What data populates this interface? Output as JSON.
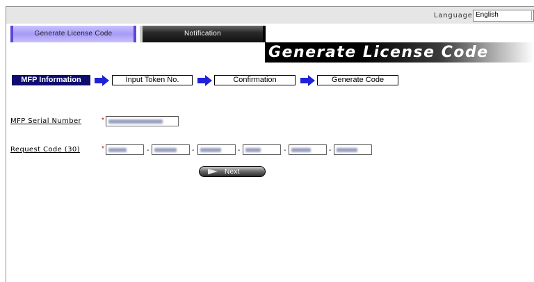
{
  "header": {
    "language_label": "Language",
    "language_value": "English"
  },
  "tabs": [
    {
      "label": "Generate License Code",
      "active": true
    },
    {
      "label": "Notification",
      "active": false
    }
  ],
  "banner": {
    "title": "Generate License Code"
  },
  "steps": [
    {
      "label": "MFP Information",
      "active": true
    },
    {
      "label": "Input Token No.",
      "active": false
    },
    {
      "label": "Confirmation",
      "active": false
    },
    {
      "label": "Generate Code",
      "active": false
    }
  ],
  "form": {
    "serial": {
      "label": "MFP Serial Number",
      "required_mark": "*"
    },
    "request_code": {
      "label": "Request Code (30)",
      "required_mark": "*",
      "separator": "-",
      "segment_count": 6
    }
  },
  "buttons": {
    "next_label": "Next"
  },
  "colors": {
    "accent_step": "#0e0c6e",
    "arrow": "#1f22d8",
    "required": "#d40000",
    "tab_active": "#a79bf5"
  }
}
